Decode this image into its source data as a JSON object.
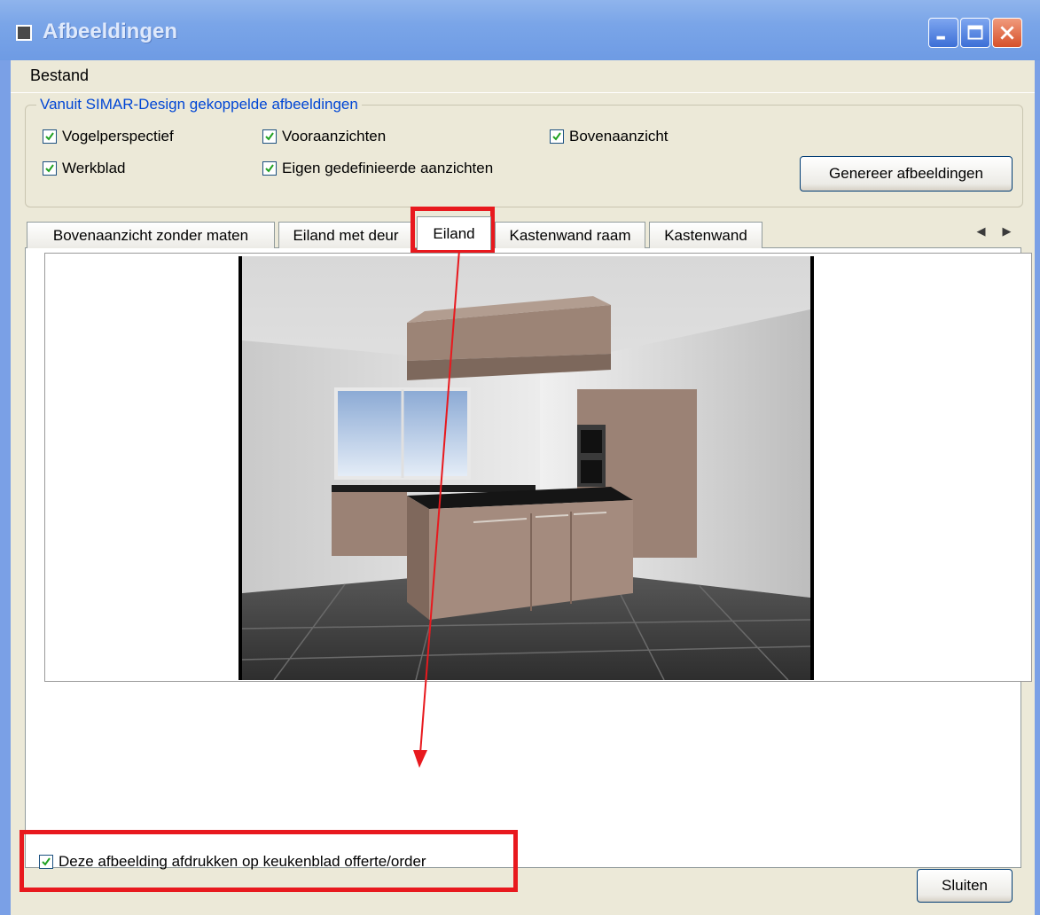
{
  "window": {
    "title": "Afbeeldingen"
  },
  "menu": {
    "items": [
      "Bestand"
    ]
  },
  "group": {
    "legend": "Vanuit SIMAR-Design gekoppelde afbeeldingen",
    "checkboxes": [
      {
        "label": "Vogelperspectief",
        "checked": true
      },
      {
        "label": "Vooraanzichten",
        "checked": true
      },
      {
        "label": "Bovenaanzicht",
        "checked": true
      },
      {
        "label": "Werkblad",
        "checked": true
      },
      {
        "label": "Eigen gedefinieerde aanzichten",
        "checked": true
      }
    ],
    "generate_button": "Genereer afbeeldingen"
  },
  "tabs": [
    {
      "label": "Bovenaanzicht zonder maten",
      "active": false
    },
    {
      "label": "Eiland met deur",
      "active": false
    },
    {
      "label": "Eiland",
      "active": true
    },
    {
      "label": "Kastenwand raam",
      "active": false
    },
    {
      "label": "Kastenwand",
      "active": false
    }
  ],
  "print_checkbox": {
    "label": "Deze afbeelding afdrukken op keukenblad offerte/order",
    "checked": true
  },
  "close_button": "Sluiten",
  "colors": {
    "titlebar": "#7aa5e8",
    "window_bg": "#ece9d8",
    "legend_text": "#0046d5",
    "highlight": "#e8191e"
  }
}
